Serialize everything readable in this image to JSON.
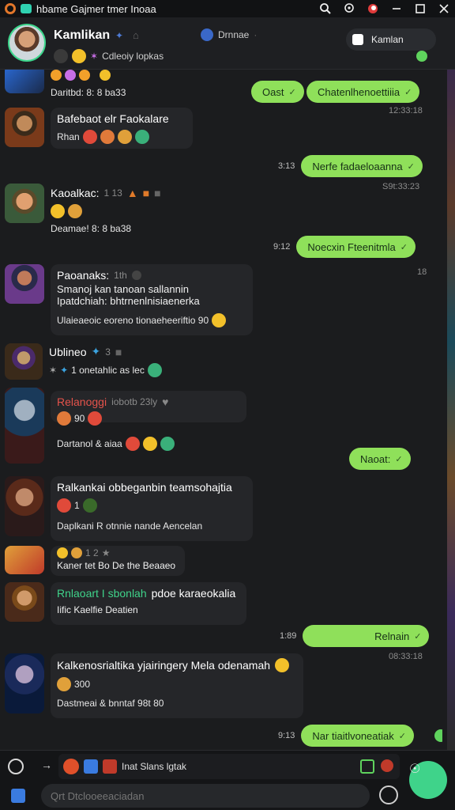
{
  "titlebar": {
    "title": "hbame Gajmer tmer Inoaa",
    "icons": [
      "app-logo",
      "app-badge",
      "search-icon",
      "location-icon",
      "status-icon",
      "minimize-icon",
      "maximize-icon",
      "close-icon"
    ]
  },
  "header": {
    "name": "Kamlikan",
    "subtitle": "Cdleoiy lopkas",
    "game": "Drnnae",
    "game_suffix": "·",
    "action_label": "Kamlan"
  },
  "messages": [
    {
      "type": "in",
      "line": "Daritbd: 8: 8 ba33"
    },
    {
      "type": "out",
      "text": "Oast",
      "ts": ""
    },
    {
      "type": "out",
      "text": "Chatenlhenoettiiia",
      "ts": ""
    },
    {
      "type": "stamp",
      "text": "12:33:18"
    },
    {
      "type": "in",
      "sender": "Bafebaot elr Faokalare",
      "line": "Rhan"
    },
    {
      "type": "out",
      "text": "Nerfe fadaeloaanna",
      "ts": "3:13"
    },
    {
      "type": "stamp",
      "text": "S9t:33:23"
    },
    {
      "type": "in",
      "sender": "Kaoalkac:",
      "meta": "1 13",
      "line": "Deamae! 8: 8 ba38"
    },
    {
      "type": "out",
      "text": "Noecxin Fteenitmla",
      "ts": "9:12"
    },
    {
      "type": "stamp",
      "text": "18"
    },
    {
      "type": "in",
      "sender": "Paoanaks:",
      "meta": "1th",
      "line1": "Smanoj kan tanoan sallannin",
      "line2": "Ipatdchiah: bhtrnenlnisiaenerka",
      "line3": "Ulaieaeoic eoreno tionaeheeriftio 90"
    },
    {
      "type": "in",
      "sender": "Ublineo",
      "meta": "3",
      "line": "1 onetahlic as lec"
    },
    {
      "type": "in",
      "sender": "Relanoggi",
      "meta": "iobotb 23ly",
      "line1": "90",
      "line2": "Dartanol & aiaa"
    },
    {
      "type": "out",
      "text": "Naoat:",
      "ts": ""
    },
    {
      "type": "in",
      "sender": "Ralkankai obbeganbin teamsohajtia",
      "meta": "1",
      "line": "Daplkani R otnnie nande Aencelan"
    },
    {
      "type": "in",
      "meta": "1 2",
      "line": "Kaner tet Bo De the Beaaeo"
    },
    {
      "type": "in",
      "sender": "Rnlaoart I sbonlah",
      "sender_extra": "pdoe karaeokalia",
      "line": "Iific Kaelfie Deatien"
    },
    {
      "type": "out",
      "text": "Relnain",
      "ts": "1:89"
    },
    {
      "type": "stamp",
      "text": "08:33:18"
    },
    {
      "type": "in",
      "sender": "Kalkenosrialtika yjairingery Mela odenamah",
      "line1": "300",
      "line2": "Dastmeai & bnntaf 98t 80"
    },
    {
      "type": "out",
      "text": "Nar tiaitlvoneatiak",
      "ts": "9:13"
    }
  ],
  "composer": {
    "quick_text": "Inat Slans lgtak",
    "placeholder": "Qrt Dtclooeeaciadan"
  },
  "colors": {
    "accent": "#8fe05a",
    "online": "#3dd68c",
    "bg": "#1b1c1e",
    "bubble_in": "#252629"
  }
}
